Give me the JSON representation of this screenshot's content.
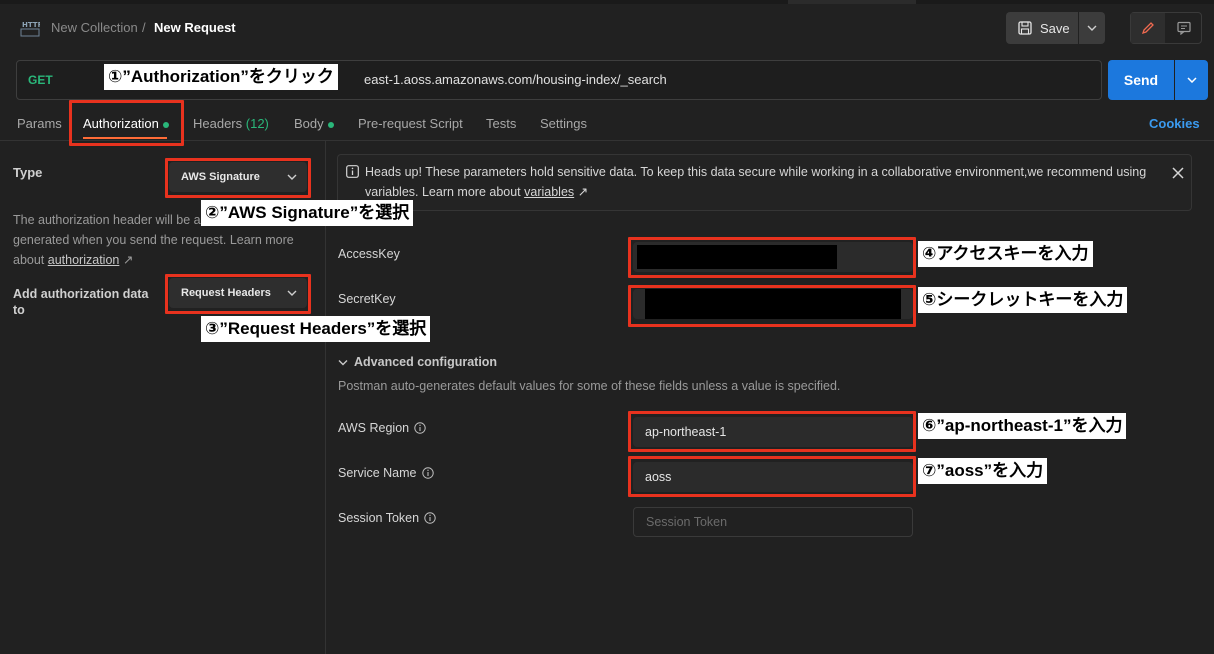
{
  "header": {
    "breadcrumb_collection": "New Collection",
    "breadcrumb_sep": "/",
    "breadcrumb_request": "New Request",
    "save_label": "Save",
    "http_icon_text": "HTTP"
  },
  "request": {
    "method": "GET",
    "url_visible": "east-1.aoss.amazonaws.com/housing-index/_search",
    "send_label": "Send"
  },
  "tabs": {
    "params": "Params",
    "authorization": "Authorization",
    "headers": "Headers",
    "headers_count": "(12)",
    "body": "Body",
    "prerequest": "Pre-request Script",
    "tests": "Tests",
    "settings": "Settings",
    "cookies": "Cookies"
  },
  "auth": {
    "type_label": "Type",
    "type_value": "AWS Signature",
    "desc_1": "The authorization header will be a",
    "desc_2": "generated when you send the request. Learn more",
    "desc_3": "about",
    "desc_link": "authorization",
    "add_label": "Add authorization data to",
    "add_value": "Request Headers"
  },
  "banner": {
    "text": "Heads up! These parameters hold sensitive data. To keep this data secure while working in a collaborative environment,we recommend using variables. Learn more about",
    "link": "variables"
  },
  "fields": {
    "access_key_label": "AccessKey",
    "secret_key_label": "SecretKey",
    "advanced_label": "Advanced configuration",
    "advanced_desc": "Postman auto-generates default values for some of these fields unless a value is specified.",
    "region_label": "AWS Region",
    "region_value": "ap-northeast-1",
    "service_label": "Service Name",
    "service_value": "aoss",
    "token_label": "Session Token",
    "token_placeholder": "Session Token"
  },
  "annotations": {
    "a1": "①”Authorization”をクリック",
    "a2": "②”AWS Signature”を選択",
    "a3": "③”Request Headers”を選択",
    "a4": "④アクセスキーを入力",
    "a5": "⑤シークレットキーを入力",
    "a6": "⑥”ap-northeast-1”を入力",
    "a7": "⑦”aoss”を入力"
  },
  "colors": {
    "accent_send": "#1c78dd",
    "method_get": "#2ab77a",
    "annotation_red": "#e8321e",
    "cookies_link": "#3b9bf0"
  }
}
